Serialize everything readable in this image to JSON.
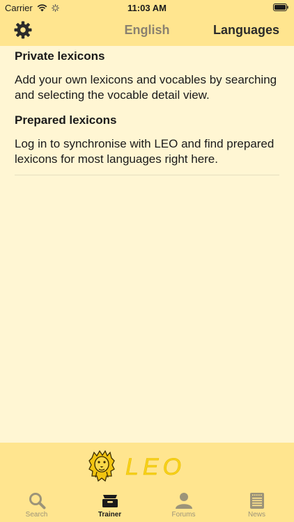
{
  "status": {
    "carrier": "Carrier",
    "time": "11:03 AM"
  },
  "nav": {
    "title": "English",
    "right_label": "Languages",
    "settings_icon": "gear-icon"
  },
  "content": {
    "sections": [
      {
        "title": "Private lexicons",
        "body": "Add your own lexicons and vocables by searching and selecting the vocable detail view."
      },
      {
        "title": "Prepared lexicons",
        "body": "Log in to synchronise with LEO and find prepared lexicons for most languages right here."
      }
    ]
  },
  "logo": {
    "text": "LEO"
  },
  "tabs": [
    {
      "label": "Search",
      "icon": "search-icon",
      "active": false
    },
    {
      "label": "Trainer",
      "icon": "trainer-box-icon",
      "active": true
    },
    {
      "label": "Forums",
      "icon": "person-icon",
      "active": false
    },
    {
      "label": "News",
      "icon": "news-icon",
      "active": false
    }
  ],
  "colors": {
    "bar_background": "#ffe58f",
    "page_background": "#fff6d3",
    "inactive_tab": "#9c9479",
    "active_tab": "#1a1a1a"
  }
}
